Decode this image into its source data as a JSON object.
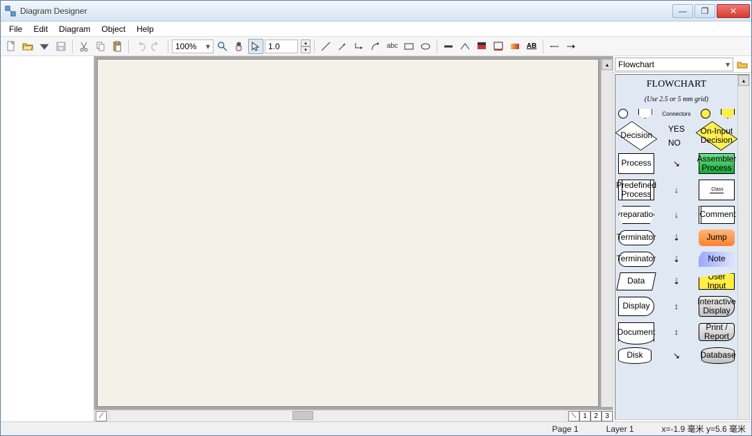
{
  "window": {
    "title": "Diagram Designer"
  },
  "menu": {
    "file": "File",
    "edit": "Edit",
    "diagram": "Diagram",
    "object": "Object",
    "help": "Help"
  },
  "toolbar": {
    "zoom": "100%",
    "spinner": "1.0"
  },
  "status": {
    "page": "Page 1",
    "layer": "Layer 1",
    "coords": "x=-1.9 毫米  y=5.6 毫米"
  },
  "rightPanel": {
    "combo": "Flowchart",
    "title": "FLOWCHART",
    "subtitle": "(Use 2.5 or 5 mm grid)",
    "connectors": "Connectors",
    "yes": "YES",
    "no": "NO",
    "shapes": {
      "decision": "Decision",
      "onInput": "On-Input Decision",
      "process": "Process",
      "assembler": "Assembler Process",
      "predefined": "Predefined Process",
      "class": "Class",
      "preparation": "Preparation",
      "comment": "Comment",
      "terminator1": "Terminator",
      "jump": "Jump",
      "terminator2": "Terminator",
      "note": "Note",
      "data": "Data",
      "userInput": "User Input",
      "display": "Display",
      "intDisplay": "Interactive Display",
      "document": "Document",
      "printReport": "Print / Report",
      "disk": "Disk",
      "database": "Database"
    }
  },
  "pageTabs": {
    "t1": "1",
    "t2": "2",
    "t3": "3"
  }
}
